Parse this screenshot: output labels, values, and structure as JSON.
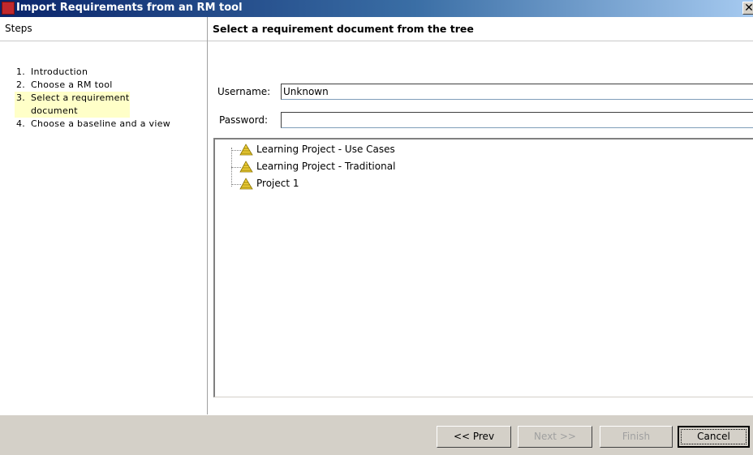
{
  "window": {
    "title": "Import Requirements from an RM tool",
    "close_glyph": "✕",
    "icon": "app-icon"
  },
  "steps": {
    "header": "Steps",
    "items": [
      {
        "num": "1.",
        "label": "Introduction",
        "current": false
      },
      {
        "num": "2.",
        "label": "Choose a RM tool",
        "current": false
      },
      {
        "num": "3.",
        "label": "Select a requirement document",
        "current": true
      },
      {
        "num": "4.",
        "label": "Choose a baseline and a view",
        "current": false
      }
    ]
  },
  "main": {
    "header": "Select a requirement document from the tree",
    "username_label": "Username:",
    "username_value": "Unknown",
    "password_label": "Password:",
    "password_value": "",
    "tree": [
      {
        "label": "Learning Project - Use Cases",
        "icon": "project-pyramid-icon"
      },
      {
        "label": "Learning Project - Traditional",
        "icon": "project-pyramid-icon"
      },
      {
        "label": "Project 1",
        "icon": "project-pyramid-icon"
      }
    ]
  },
  "buttons": {
    "prev": "<< Prev",
    "next": "Next >>",
    "finish": "Finish",
    "cancel": "Cancel"
  }
}
